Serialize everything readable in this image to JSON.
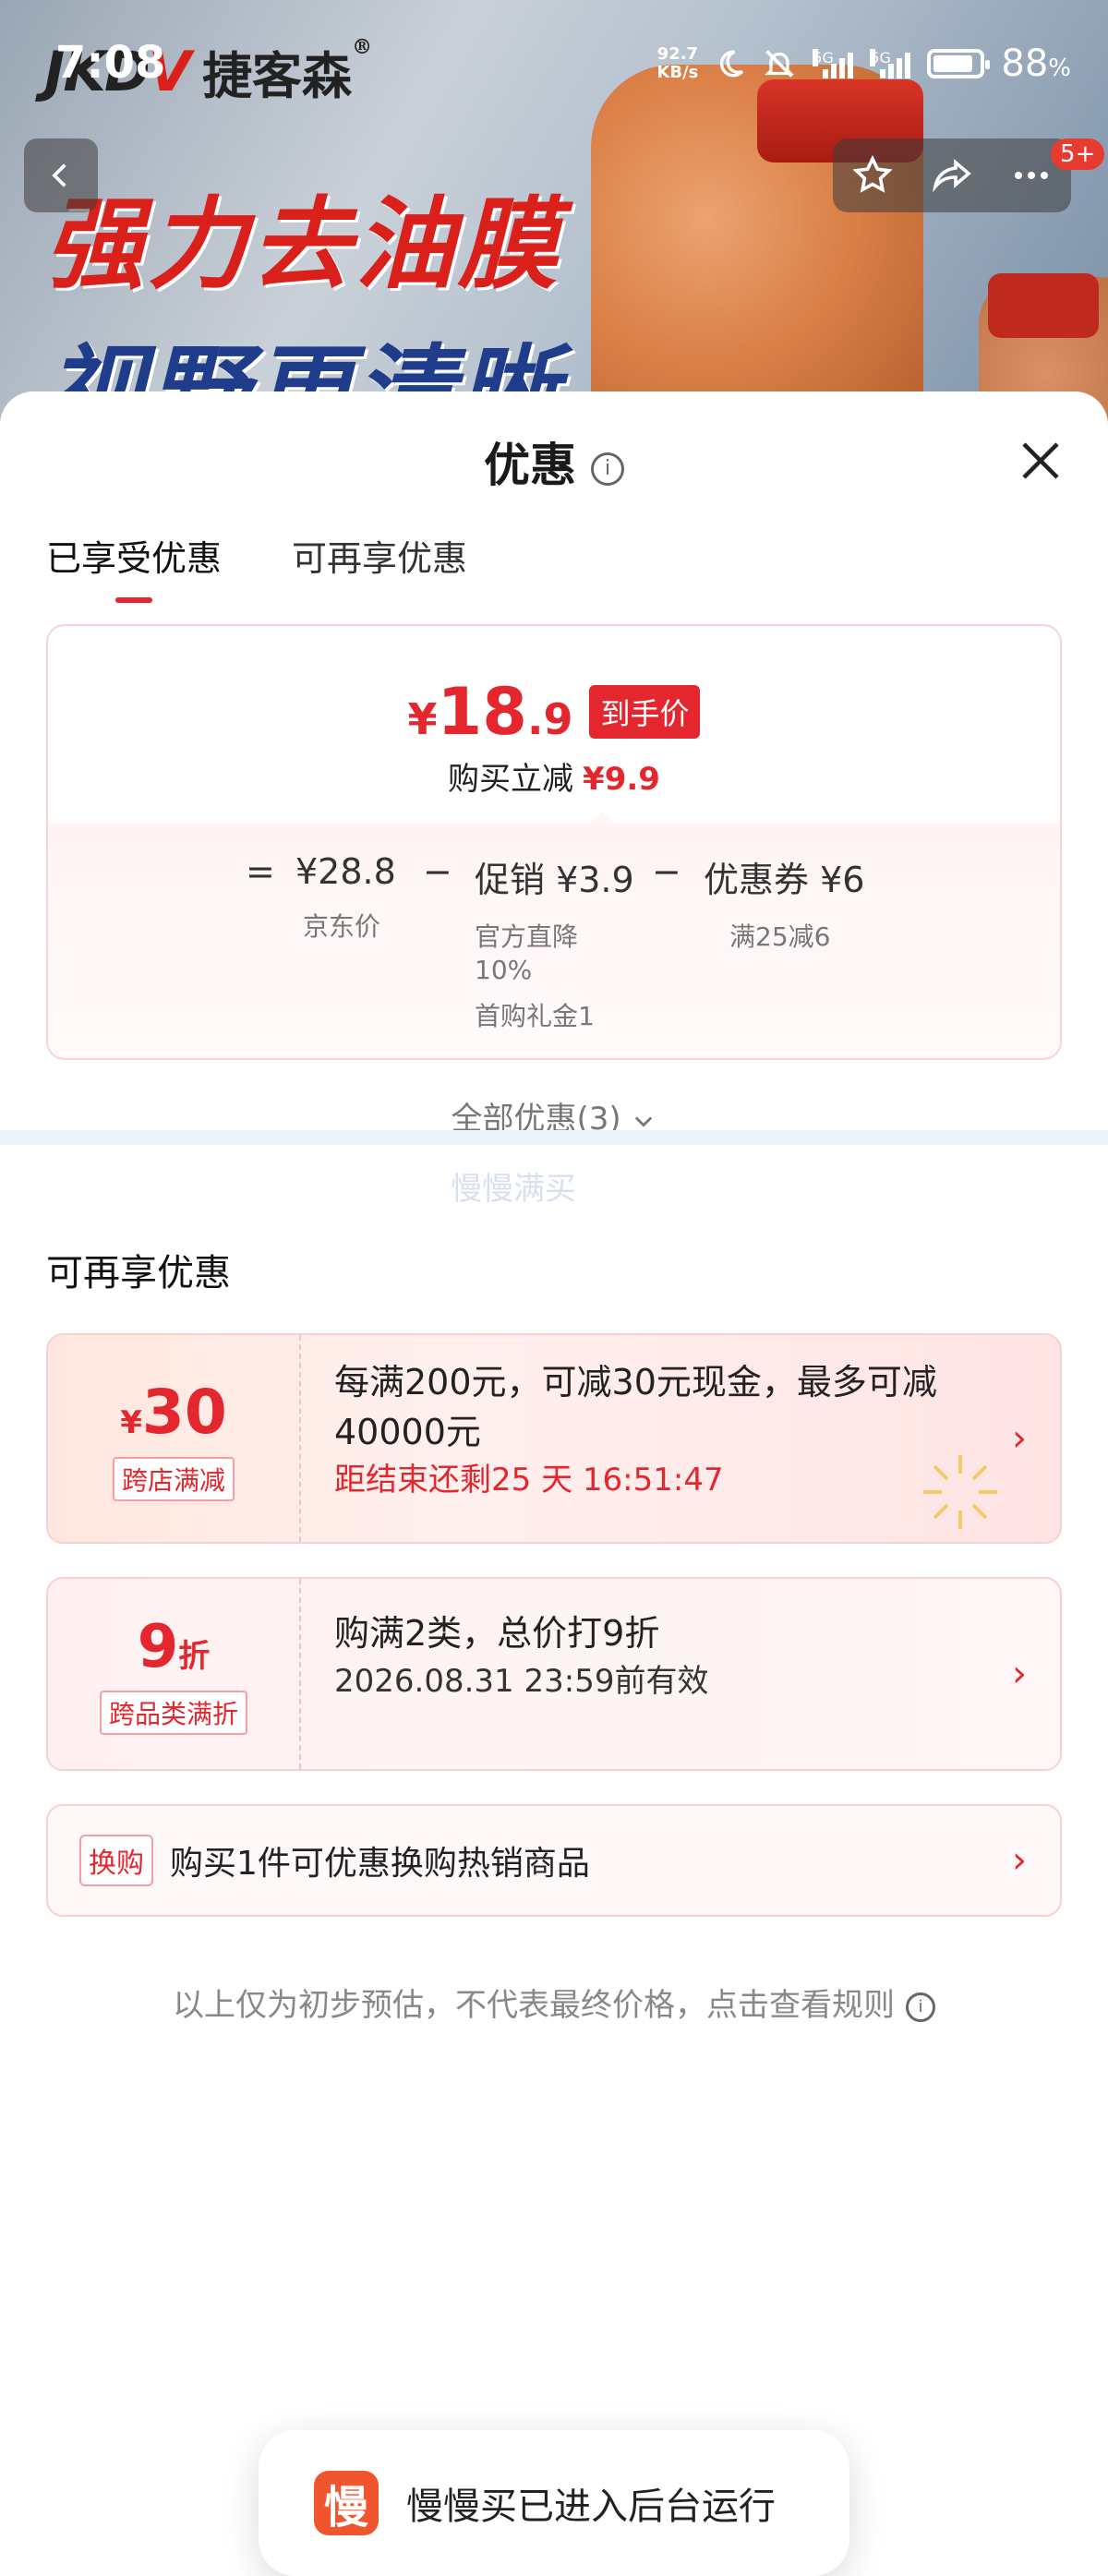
{
  "status_bar": {
    "time": "7:08",
    "net_speed_value": "92.7",
    "net_speed_unit": "KB/s",
    "signal1_label": "5G",
    "signal2_label": "5G",
    "battery_level": 0.88,
    "battery_text": "88",
    "battery_pct_sign": "%"
  },
  "banner": {
    "brand_logo_left": "JKD",
    "brand_logo_v": "V",
    "brand_name": "捷客森",
    "brand_reg": "®",
    "slogan_line1": "强力去油膜",
    "slogan_line2": "视野更清晰",
    "notif_badge": "5+"
  },
  "sheet": {
    "title": "优惠",
    "info_glyph": "i",
    "close_icon": "close-icon",
    "tabs": [
      {
        "label": "已享受优惠",
        "active": true
      },
      {
        "label": "可再享优惠",
        "active": false
      }
    ]
  },
  "price_card": {
    "yen": "¥",
    "price_int": "18",
    "price_dec": ".9",
    "badge": "到手价",
    "reduce_label": "购买立减",
    "reduce_amount": "¥9.9",
    "eq": "=",
    "jd_price": "¥28.8",
    "jd_price_label": "京东价",
    "minus1": "−",
    "promo": "促销 ¥3.9",
    "promo_desc1": "官方直降",
    "promo_desc2": "10%",
    "promo_desc3": "首购礼金1",
    "minus2": "−",
    "coupon": "优惠券 ¥6",
    "coupon_desc": "满25减6"
  },
  "all_discounts": "全部优惠(3)",
  "watermark_text": "慢慢满买",
  "more_section": {
    "title": "可再享优惠",
    "cards": [
      {
        "amount_prefix": "¥",
        "amount": "30",
        "tag": "跨店满减",
        "text": "每满200元，可减30元现金，最多可减40000元",
        "sub": "距结束还剩25 天 16:51:47"
      },
      {
        "amount": "9",
        "amount_suffix": "折",
        "tag": "跨品类满折",
        "text": "购满2类，总价打9折",
        "sub": "2026.08.31 23:59前有效"
      },
      {
        "tag": "换购",
        "text": "购买1件可优惠换购热销商品"
      }
    ],
    "chevron": "›"
  },
  "note": "以上仅为初步预估，不代表最终价格，点击查看规则",
  "toast": {
    "icon_char": "慢",
    "text": "慢慢买已进入后台运行"
  },
  "colors": {
    "accent": "#e4262e",
    "toast_icon": "#f0552d"
  }
}
